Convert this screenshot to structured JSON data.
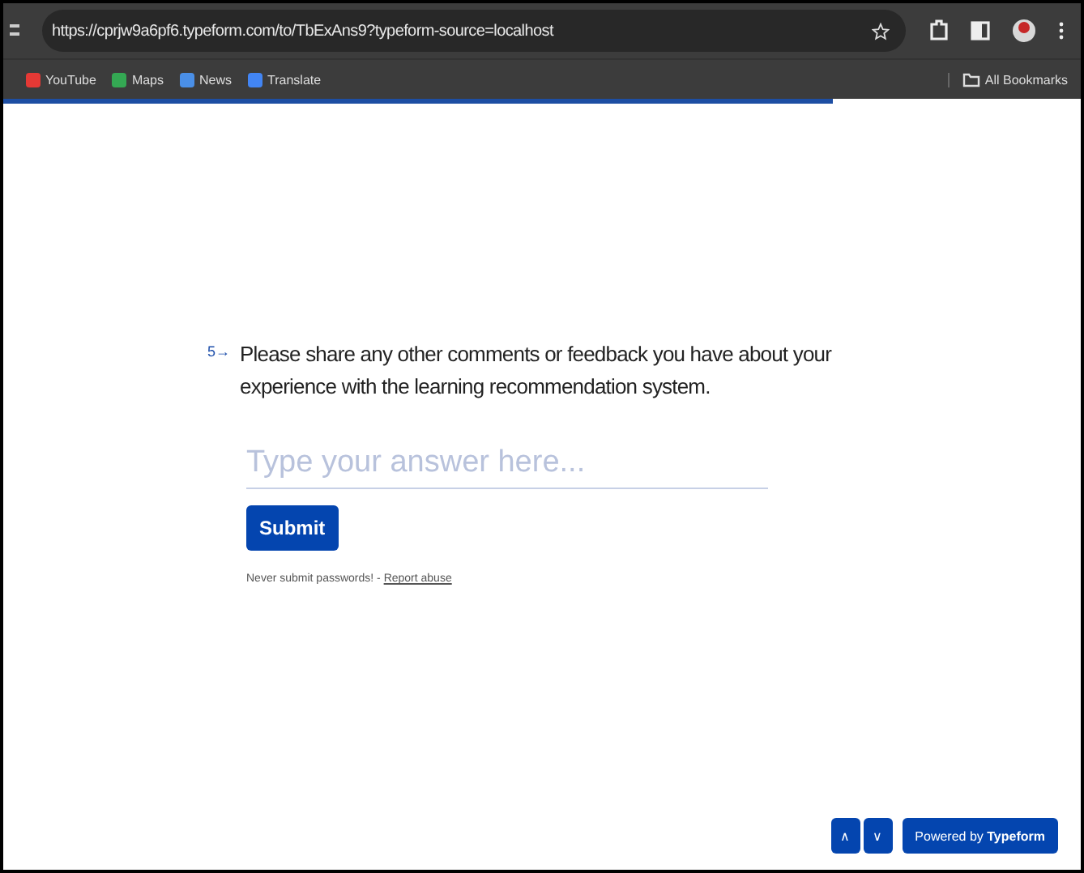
{
  "browser": {
    "url": "https://cprjw9a6pf6.typeform.com/to/TbExAns9?typeform-source=localhost",
    "bookmarks": [
      {
        "label": "YouTube"
      },
      {
        "label": "Maps"
      },
      {
        "label": "News"
      },
      {
        "label": "Translate"
      }
    ],
    "all_bookmarks": "All Bookmarks"
  },
  "progress": {
    "level": 0.77
  },
  "question": {
    "number": "5",
    "arrow": "→",
    "text": "Please share any other comments or feedback you have about your experience with the learning recommendation system.",
    "placeholder": "Type your answer here...",
    "submit": "Submit",
    "note": "Never submit passwords! - ",
    "report_link": "Report abuse"
  },
  "footer": {
    "up": "∧",
    "down": "∨",
    "powered": "Powered by **Typeform**"
  }
}
